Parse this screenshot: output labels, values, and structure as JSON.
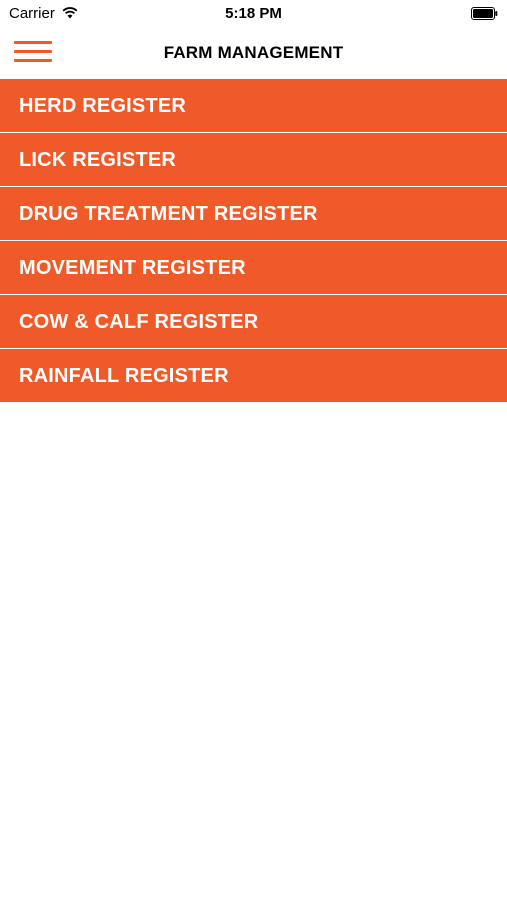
{
  "status_bar": {
    "carrier": "Carrier",
    "time": "5:18 PM",
    "wifi_icon": "wifi-icon",
    "battery_icon": "battery-full-icon"
  },
  "nav": {
    "title": "FARM MANAGEMENT",
    "menu_icon": "hamburger-menu-icon"
  },
  "colors": {
    "accent": "#f05a28",
    "background": "#ffffff"
  },
  "menu": {
    "items": [
      {
        "label": "HERD REGISTER"
      },
      {
        "label": "LICK REGISTER"
      },
      {
        "label": "DRUG TREATMENT REGISTER"
      },
      {
        "label": "MOVEMENT REGISTER"
      },
      {
        "label": "COW & CALF REGISTER"
      },
      {
        "label": "RAINFALL REGISTER"
      }
    ]
  }
}
